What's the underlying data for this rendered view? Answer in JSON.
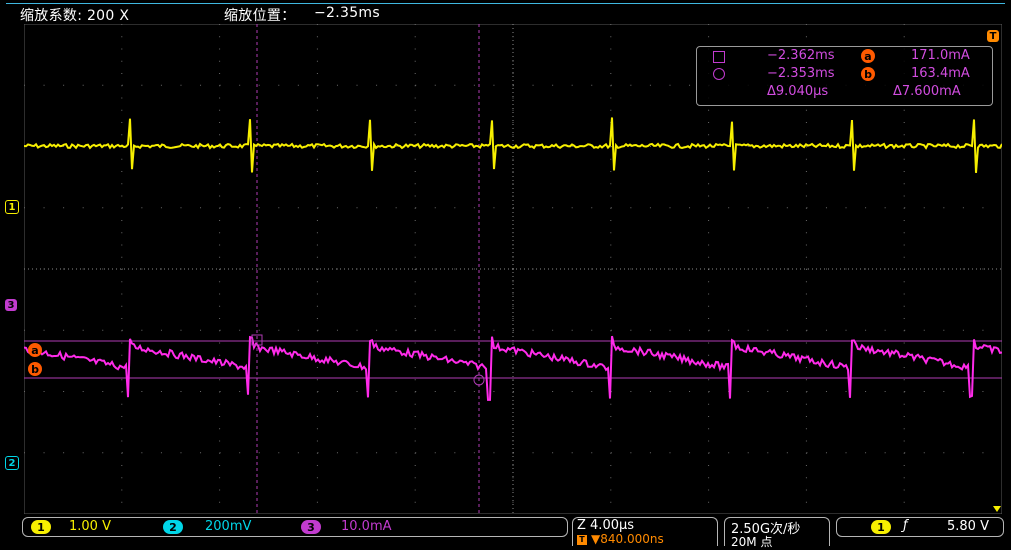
{
  "header": {
    "zoom_label": "缩放系数: 200 X",
    "position_label": "缩放位置：",
    "position_value": "−2.35ms"
  },
  "markers": {
    "trigger": "T",
    "ch1": "1",
    "ch3": "3",
    "ch2": "2",
    "cursor_a": "a",
    "cursor_b": "b"
  },
  "cursor_readout": {
    "time_a": "−2.362ms",
    "val_a": "171.0mA",
    "time_b": "−2.353ms",
    "val_b": "163.4mA",
    "delta_t": "Δ9.040µs",
    "delta_v": "Δ7.600mA"
  },
  "channels": [
    {
      "num": "1",
      "scale": "1.00 V",
      "color": "#f7ef00"
    },
    {
      "num": "2",
      "scale": "200mV",
      "color": "#00d6e8"
    },
    {
      "num": "3",
      "scale": "10.0mA",
      "color": "#c23bcf"
    }
  ],
  "timebase": {
    "zoom_scale": "Z 4.00µs",
    "trigger_pos": "▼840.000ns"
  },
  "acquisition": {
    "rate": "2.50G次/秒",
    "length": "20M 点"
  },
  "trigger": {
    "channel": "1",
    "slope_symbol": "ƒ",
    "level": "5.80 V"
  },
  "colors": {
    "ch1": "#f7ef00",
    "ch2": "#00d6e8",
    "ch3": "#c23bcf",
    "ch3_trace": "#ff2bea",
    "trigger": "#ff8a00",
    "cursor": "#ff5a00"
  }
}
